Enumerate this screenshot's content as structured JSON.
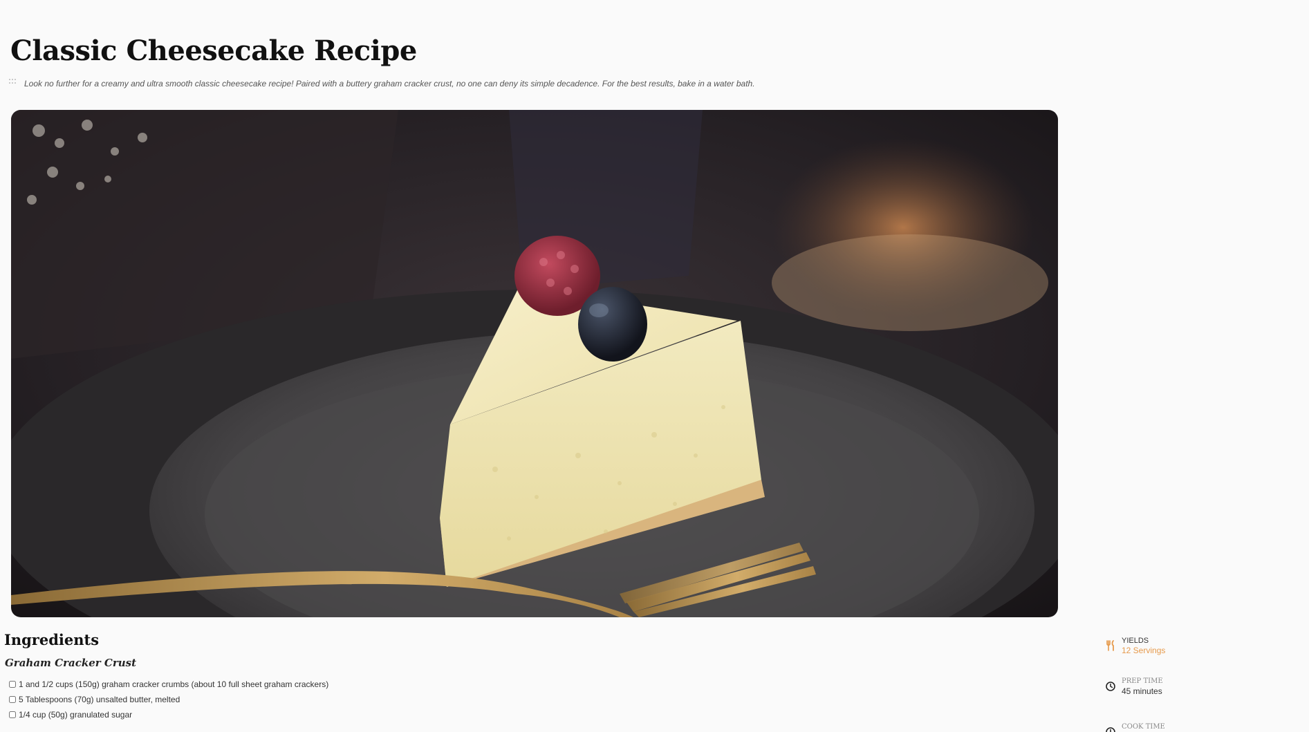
{
  "recipe": {
    "title": "Classic Cheesecake Recipe",
    "intro": "Look no further for a creamy and ultra smooth classic cheesecake recipe! Paired with a buttery graham cracker crust, no one can deny its simple decadence. For the best results, bake in a water bath."
  },
  "ingredients": {
    "heading": "Ingredients",
    "sections": [
      {
        "title": "Graham Cracker Crust",
        "items": [
          "1 and 1/2 cups (150g) graham cracker crumbs (about 10 full sheet graham crackers)",
          "5 Tablespoons (70g) unsalted butter, melted",
          "1/4 cup (50g) granulated sugar"
        ]
      }
    ]
  },
  "meta": {
    "yields": {
      "label": "YIELDS",
      "value": "12 Servings"
    },
    "prep_time": {
      "label": "PREP TIME",
      "value": "45 minutes"
    },
    "cook_time": {
      "label": "COOK TIME"
    }
  },
  "colors": {
    "accent": "#e69a4c",
    "background": "#fafafa",
    "text": "#1a1a1a"
  },
  "icons": {
    "drag": "drag-handle-icon",
    "yields": "fork-knife-icon",
    "prep": "clock-icon",
    "cook": "clock-icon"
  }
}
